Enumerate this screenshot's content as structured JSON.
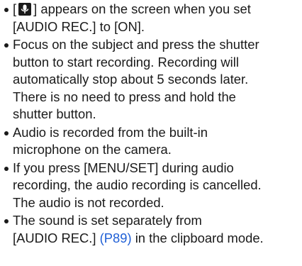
{
  "notes": [
    {
      "lines": [
        {
          "pre": "[",
          "icon": "microphone-icon",
          "post": "] appears on the screen when you set"
        },
        {
          "text": "[AUDIO REC.] to [ON]."
        }
      ]
    },
    {
      "lines": [
        {
          "text": "Focus on the subject and press the shutter"
        },
        {
          "text": "button to start recording. Recording will"
        },
        {
          "text": "automatically stop about 5 seconds later."
        },
        {
          "text": "There is no need to press and hold the"
        },
        {
          "text": "shutter button."
        }
      ]
    },
    {
      "lines": [
        {
          "text": "Audio is recorded from the built-in"
        },
        {
          "text": "microphone on the camera."
        }
      ]
    },
    {
      "lines": [
        {
          "text": "If you press [MENU/SET] during audio"
        },
        {
          "text": "recording, the audio recording is cancelled."
        },
        {
          "text": "The audio is not recorded."
        }
      ]
    },
    {
      "lines": [
        {
          "text": "The sound is set separately from"
        },
        {
          "text": "[AUDIO REC.] ",
          "link": "(P89)",
          "post": " in the clipboard mode."
        }
      ]
    }
  ],
  "colors": {
    "text": "#1a1a1a",
    "link": "#1f5fd6"
  }
}
